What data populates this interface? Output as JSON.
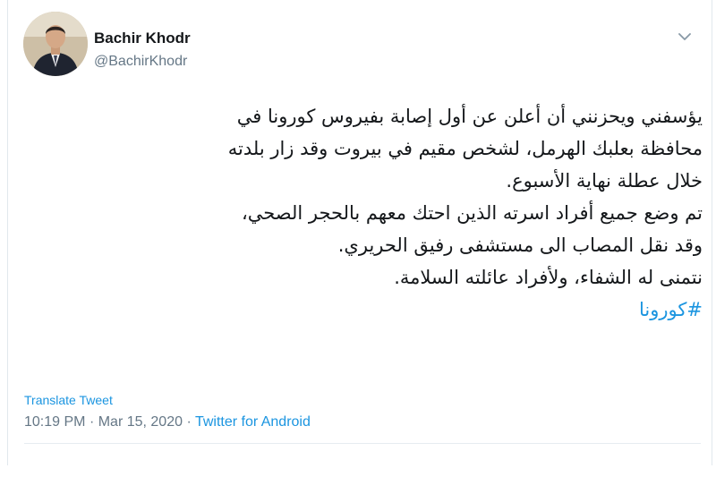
{
  "author": {
    "name": "Bachir Khodr",
    "handle": "@BachirKhodr"
  },
  "tweet": {
    "lines": [
      "يؤسفني ويحزنني أن أعلن عن أول إصابة بفيروس كورونا في",
      "محافظة بعلبك الهرمل، لشخص مقيم في بيروت وقد زار بلدته",
      "خلال عطلة نهاية الأسبوع.",
      "تم وضع جميع أفراد اسرته الذين احتك معهم بالحجر الصحي،",
      "وقد نقل المصاب الى مستشفى رفيق الحريري.",
      "نتمنى له الشفاء، ولأفراد عائلته السلامة."
    ],
    "hashtag": "#كورونا"
  },
  "translate_label": "Translate Tweet",
  "meta": {
    "time": "10:19 PM",
    "separator": "·",
    "date": "Mar 15, 2020",
    "source": "Twitter for Android"
  },
  "icons": {
    "caret": "chevron-down-icon"
  },
  "colors": {
    "text": "#14171a",
    "secondary": "#657786",
    "link": "#1b95e0",
    "border": "#e1e8ed"
  }
}
